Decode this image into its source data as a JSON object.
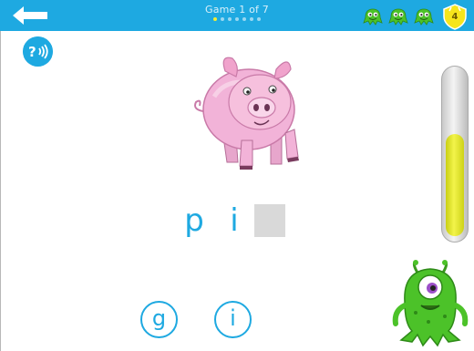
{
  "topbar": {
    "game_title": "Game 1 of 7",
    "progress": {
      "total": 7,
      "current": 1
    },
    "lives_count": 3,
    "badge_number": "4"
  },
  "help": {
    "icon": "question-sound-icon"
  },
  "word": {
    "letters": [
      "p",
      "i"
    ],
    "blank": ""
  },
  "options": [
    "g",
    "i"
  ],
  "meter": {
    "level": 0.62
  },
  "colors": {
    "accent": "#1ea9e1",
    "meter_fill": "#eef03a",
    "slot": "#d9d9d9",
    "monster": "#4cc229",
    "badge": "#f6e51c"
  }
}
